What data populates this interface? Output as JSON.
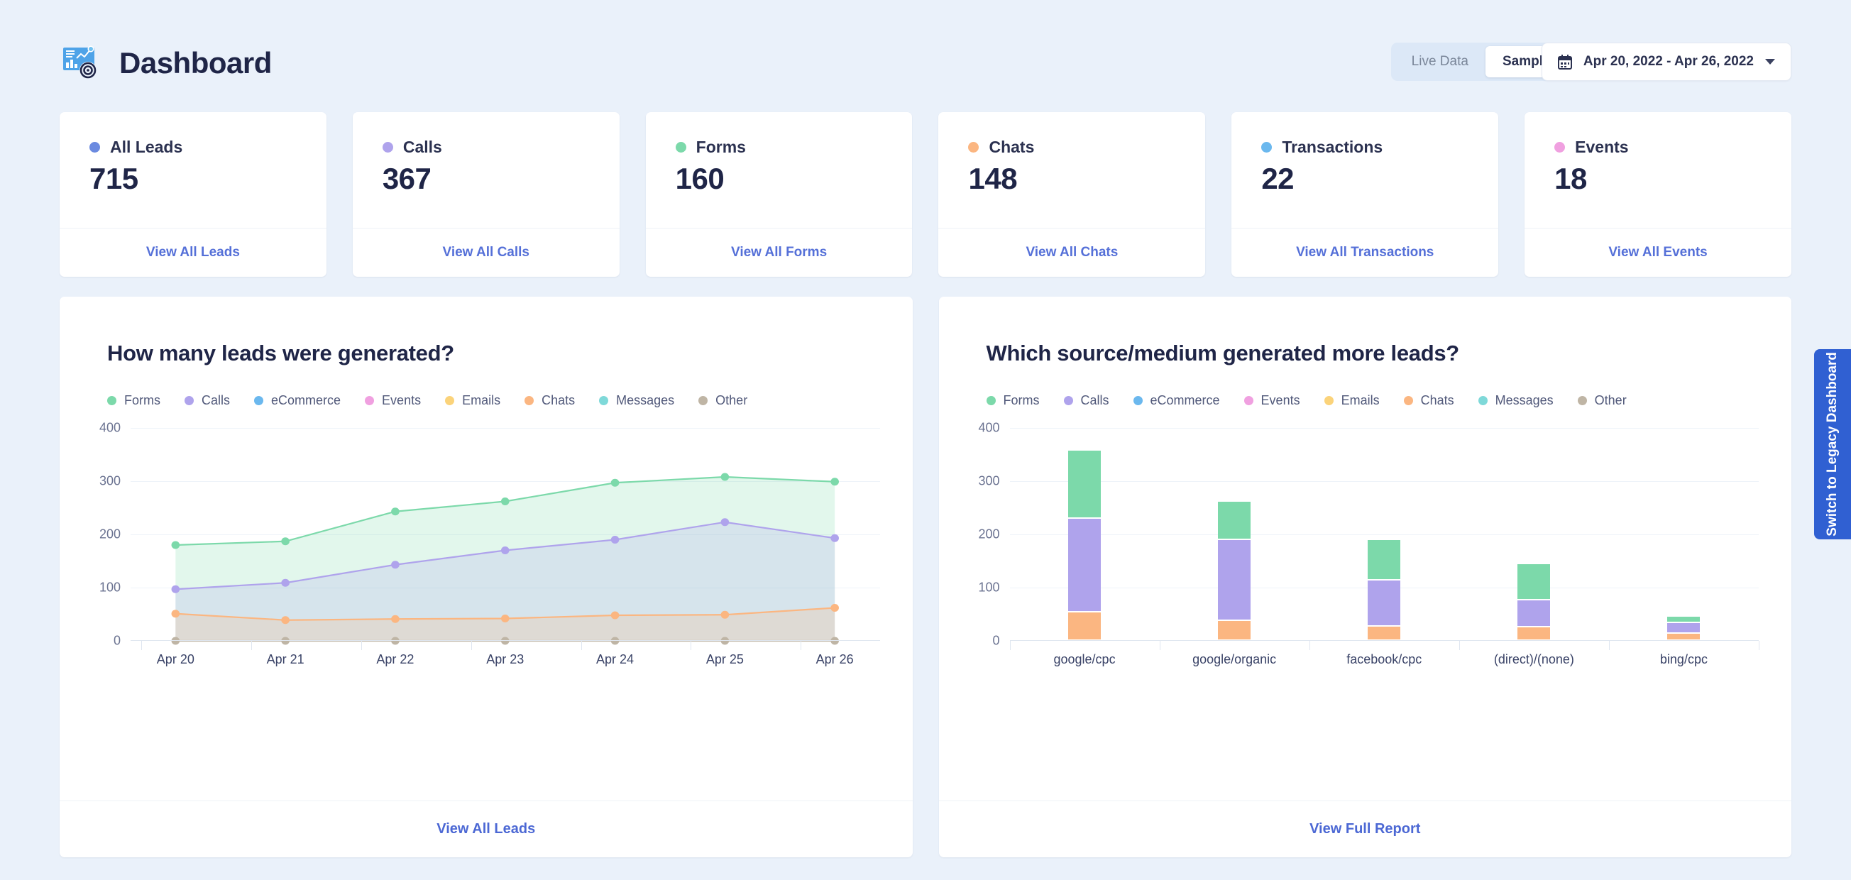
{
  "header": {
    "title": "Dashboard",
    "logo_icon": "analytics-dashboard-icon",
    "toggle": {
      "live_label": "Live Data",
      "sample_label": "Sample Data",
      "selected": "Sample Data"
    },
    "date_range": "Apr 20, 2022 - Apr 26, 2022",
    "calendar_icon": "calendar-icon",
    "chevron_icon": "chevron-down-icon"
  },
  "side_tab": {
    "label": "Switch to Legacy Dashboard",
    "color": "#3060d2"
  },
  "kpis": [
    {
      "label": "All Leads",
      "value": "715",
      "link": "View All Leads",
      "color": "#6b8ae0"
    },
    {
      "label": "Calls",
      "value": "367",
      "link": "View All Calls",
      "color": "#afa3ec"
    },
    {
      "label": "Forms",
      "value": "160",
      "link": "View All Forms",
      "color": "#7cd9aa"
    },
    {
      "label": "Chats",
      "value": "148",
      "link": "View All Chats",
      "color": "#fbb681"
    },
    {
      "label": "Transactions",
      "value": "22",
      "link": "View All Transactions",
      "color": "#6bb8ee"
    },
    {
      "label": "Events",
      "value": "18",
      "link": "View All Events",
      "color": "#f0a0e0"
    }
  ],
  "legend_series": [
    {
      "label": "Forms",
      "color": "#7cd9aa"
    },
    {
      "label": "Calls",
      "color": "#afa3ec"
    },
    {
      "label": "eCommerce",
      "color": "#6bb8ee"
    },
    {
      "label": "Events",
      "color": "#f0a0e0"
    },
    {
      "label": "Emails",
      "color": "#fbd37a"
    },
    {
      "label": "Chats",
      "color": "#fbb681"
    },
    {
      "label": "Messages",
      "color": "#7fd9d9"
    },
    {
      "label": "Other",
      "color": "#bfb5a5"
    }
  ],
  "left_card": {
    "footer_link": "View All Leads"
  },
  "right_card": {
    "footer_link": "View Full Report"
  },
  "chart_data": [
    {
      "type": "area",
      "title": "How many leads were generated?",
      "xlabel": "",
      "ylabel": "",
      "ylim": [
        0,
        400
      ],
      "yticks": [
        0,
        100,
        200,
        300,
        400
      ],
      "grid": true,
      "legend_position": "top-left",
      "stacked": false,
      "categories": [
        "Apr 20",
        "Apr 21",
        "Apr 22",
        "Apr 23",
        "Apr 24",
        "Apr 25",
        "Apr 26"
      ],
      "series": [
        {
          "name": "Forms",
          "color": "#7cd9aa",
          "values": [
            180,
            187,
            243,
            262,
            297,
            308,
            299
          ]
        },
        {
          "name": "Calls",
          "color": "#afa3ec",
          "values": [
            97,
            109,
            143,
            170,
            190,
            223,
            193
          ]
        },
        {
          "name": "Chats",
          "color": "#fbb681",
          "values": [
            51,
            39,
            41,
            42,
            48,
            49,
            62
          ]
        },
        {
          "name": "Other",
          "color": "#bfb5a5",
          "values": [
            0,
            0,
            0,
            0,
            0,
            0,
            0
          ]
        }
      ]
    },
    {
      "type": "bar",
      "title": "Which source/medium generated more leads?",
      "xlabel": "",
      "ylabel": "",
      "ylim": [
        0,
        400
      ],
      "yticks": [
        0,
        100,
        200,
        300,
        400
      ],
      "grid": true,
      "stacked": true,
      "legend_position": "top-left",
      "categories": [
        "google/cpc",
        "google/organic",
        "facebook/cpc",
        "(direct)/(none)",
        "bing/cpc"
      ],
      "series": [
        {
          "name": "Chats",
          "color": "#fbb681",
          "values": [
            53,
            38,
            27,
            26,
            14
          ]
        },
        {
          "name": "Calls",
          "color": "#afa3ec",
          "values": [
            176,
            151,
            86,
            50,
            20
          ]
        },
        {
          "name": "Forms",
          "color": "#7cd9aa",
          "values": [
            128,
            73,
            77,
            68,
            12
          ]
        }
      ],
      "totals": [
        357,
        262,
        190,
        144,
        46
      ]
    }
  ]
}
